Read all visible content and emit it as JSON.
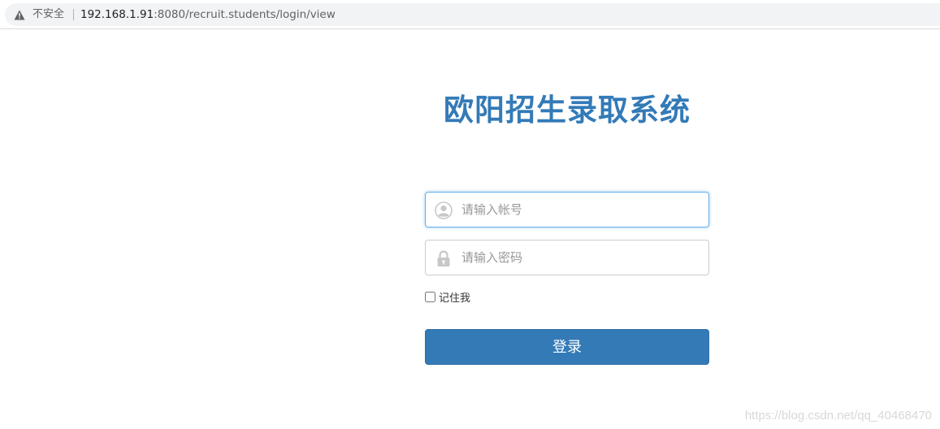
{
  "browser": {
    "security_label": "不安全",
    "url_host": "192.168.1.91",
    "url_rest": ":8080/recruit.students/login/view",
    "warning_icon": "warning-triangle-icon"
  },
  "page": {
    "title": "欧阳招生录取系统"
  },
  "form": {
    "username_placeholder": "请输入帐号",
    "username_value": "",
    "username_icon": "user-icon",
    "password_placeholder": "请输入密码",
    "password_value": "",
    "password_icon": "lock-icon",
    "remember_label": "记住我",
    "remember_checked": false,
    "login_label": "登录"
  },
  "watermark": {
    "text": "https://blog.csdn.net/qq_40468470"
  },
  "colors": {
    "accent": "#337ab7",
    "focus_border": "#66afe9",
    "icon_gray": "#c8c8c8"
  }
}
